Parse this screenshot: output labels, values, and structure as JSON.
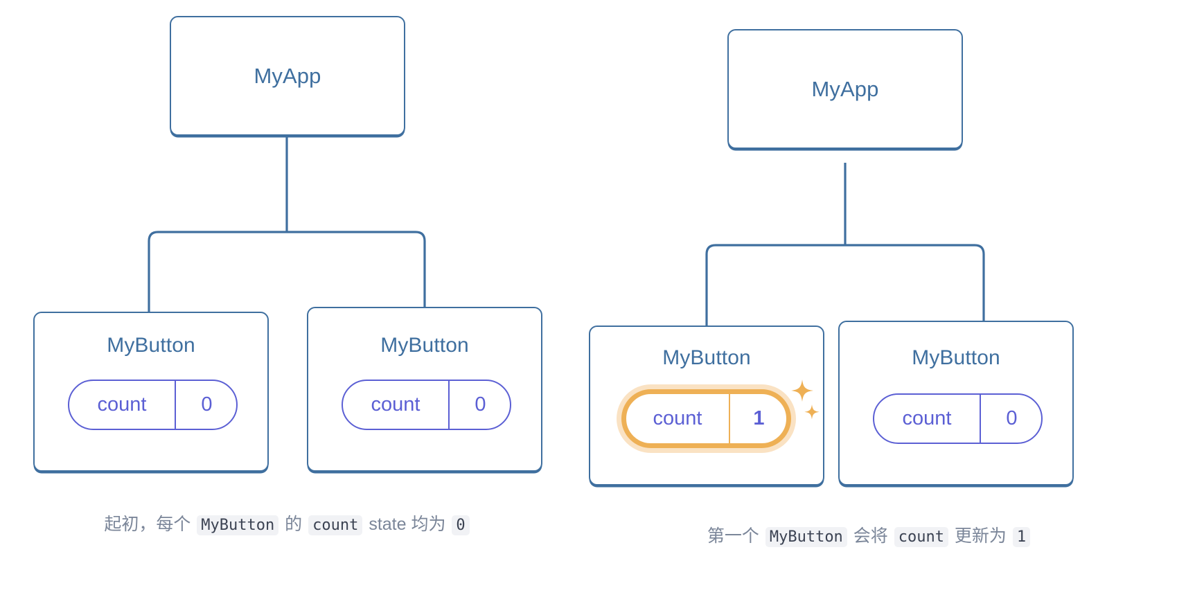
{
  "background": "#ffffff",
  "colors": {
    "box_border": "#3f6f9f",
    "box_text": "#3f6f9f",
    "pill_border": "#5b5fd4",
    "pill_text": "#5b5fd4",
    "highlight": "#eeb055",
    "highlight_glow": "#f3be7b",
    "caption_text": "#7b8699",
    "code_chip_bg": "#f1f2f5",
    "code_chip_text": "#3b4252",
    "connector": "#3f6f9f"
  },
  "panels": [
    {
      "id": "initial-state",
      "root": {
        "label": "MyApp"
      },
      "children": [
        {
          "label": "MyButton",
          "state": {
            "key": "count",
            "value": "0"
          },
          "highlighted": false,
          "sparkles": false
        },
        {
          "label": "MyButton",
          "state": {
            "key": "count",
            "value": "0"
          },
          "highlighted": false,
          "sparkles": false
        }
      ],
      "caption": {
        "segments": [
          {
            "type": "text",
            "text": "起初，每个 "
          },
          {
            "type": "code",
            "text": "MyButton"
          },
          {
            "type": "text",
            "text": " 的 "
          },
          {
            "type": "code",
            "text": "count"
          },
          {
            "type": "text",
            "text": " state 均为 "
          },
          {
            "type": "code",
            "text": "0"
          }
        ],
        "plain": "起初，每个 MyButton 的 count state 均为 0"
      }
    },
    {
      "id": "after-click",
      "root": {
        "label": "MyApp"
      },
      "children": [
        {
          "label": "MyButton",
          "state": {
            "key": "count",
            "value": "1"
          },
          "highlighted": true,
          "sparkles": true
        },
        {
          "label": "MyButton",
          "state": {
            "key": "count",
            "value": "0"
          },
          "highlighted": false,
          "sparkles": false
        }
      ],
      "caption": {
        "segments": [
          {
            "type": "text",
            "text": "第一个 "
          },
          {
            "type": "code",
            "text": "MyButton"
          },
          {
            "type": "text",
            "text": " 会将 "
          },
          {
            "type": "code",
            "text": "count"
          },
          {
            "type": "text",
            "text": " 更新为 "
          },
          {
            "type": "code",
            "text": "1"
          }
        ],
        "plain": "第一个 MyButton 会将 count 更新为 1"
      }
    }
  ],
  "icons": {
    "sparkle": "sparkle-icon"
  }
}
